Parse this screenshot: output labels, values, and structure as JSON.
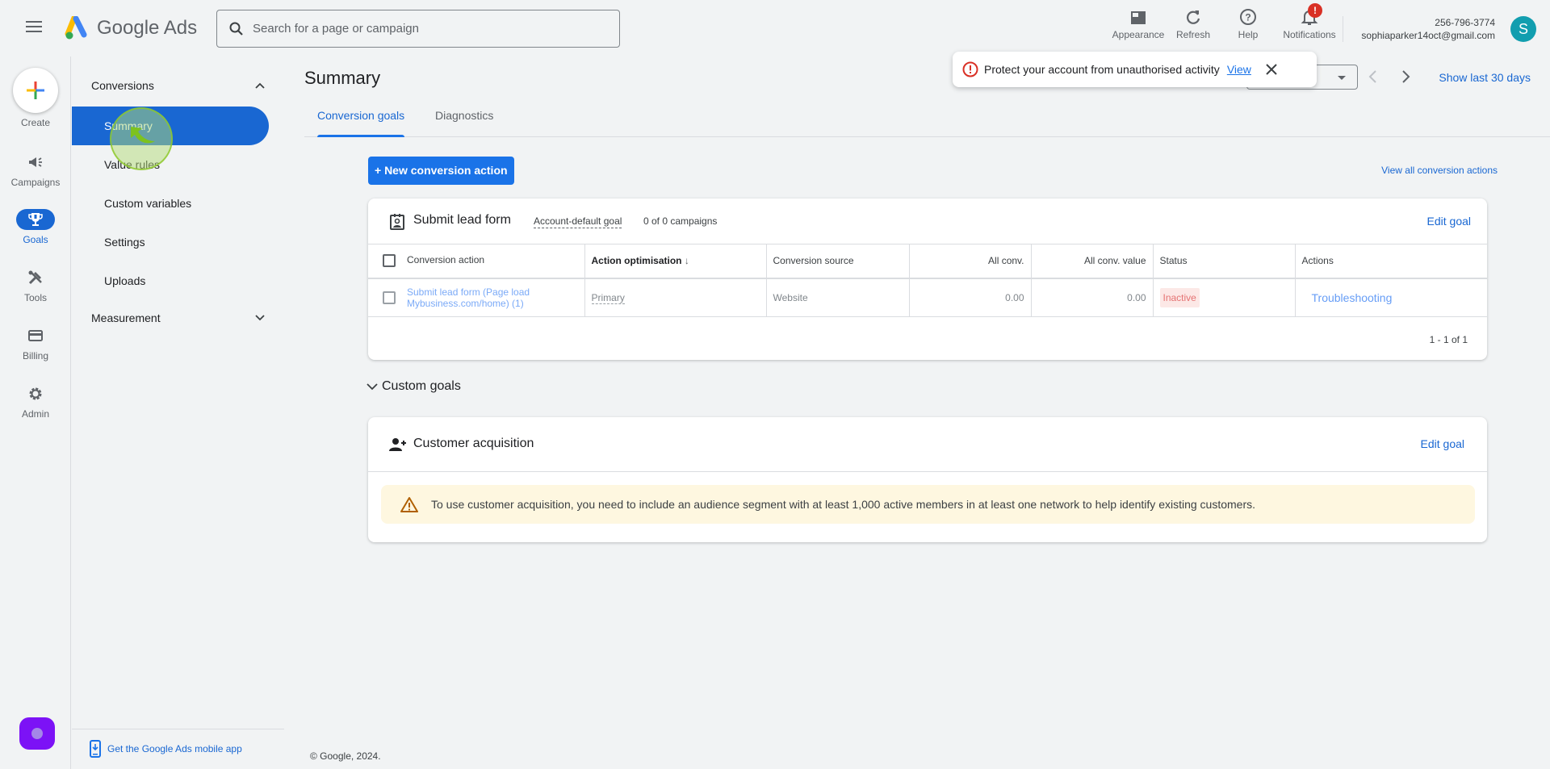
{
  "app": {
    "title": "Google Ads",
    "search_placeholder": "Search for a page or campaign"
  },
  "top_actions": [
    {
      "label": "Appearance",
      "icon": "appearance-icon"
    },
    {
      "label": "Refresh",
      "icon": "refresh-icon"
    },
    {
      "label": "Help",
      "icon": "help-icon"
    },
    {
      "label": "Notifications",
      "icon": "bell-icon",
      "badge": "!"
    }
  ],
  "account": {
    "phone": "256-796-3774",
    "email": "sophiaparker14oct@gmail.com",
    "avatar_letter": "S"
  },
  "rail": {
    "create_label": "Create",
    "items": [
      {
        "label": "Campaigns",
        "icon": "megaphone-icon"
      },
      {
        "label": "Goals",
        "icon": "trophy-icon",
        "active": true
      },
      {
        "label": "Tools",
        "icon": "tools-icon"
      },
      {
        "label": "Billing",
        "icon": "credit-card-icon"
      },
      {
        "label": "Admin",
        "icon": "gear-icon"
      }
    ]
  },
  "subnav": {
    "groups": [
      {
        "label": "Conversions",
        "expanded": true
      },
      {
        "label": "Measurement",
        "expanded": false
      }
    ],
    "items": [
      {
        "label": "Summary",
        "active": true
      },
      {
        "label": "Value rules"
      },
      {
        "label": "Custom variables"
      },
      {
        "label": "Settings"
      },
      {
        "label": "Uploads"
      }
    ],
    "mobile_app_link": "Get the Google Ads mobile app"
  },
  "main": {
    "page_title": "Summary",
    "tabs": [
      {
        "label": "Conversion goals",
        "active": true
      },
      {
        "label": "Diagnostics"
      }
    ],
    "date_range_label": "Show last 30 days",
    "new_action_label": "+ New conversion action",
    "view_all_label": "View all conversion actions",
    "goal_card": {
      "title": "Submit lead form",
      "chip": "Account-default goal",
      "campaigns": "0 of 0 campaigns",
      "edit_label": "Edit goal",
      "columns": [
        "Conversion action",
        "Action optimisation",
        "Conversion source",
        "All conv.",
        "All conv. value",
        "Status",
        "Actions"
      ],
      "rows": [
        {
          "action": "Submit lead form (Page load Mybusiness.com/home) (1)",
          "optimisation": "Primary",
          "source": "Website",
          "all_conv": "0.00",
          "all_conv_value": "0.00",
          "status": "Inactive",
          "actions": "Troubleshooting"
        }
      ],
      "pagination": "1 - 1 of 1"
    },
    "custom_goals_label": "Custom goals",
    "customer_card": {
      "title": "Customer acquisition",
      "edit_label": "Edit goal",
      "warning": "To use customer acquisition, you need to include an audience segment with at least 1,000 active members in at least one network to help identify existing customers."
    },
    "copyright": "© Google, 2024."
  },
  "toast": {
    "message": "Protect your account from unauthorised activity",
    "link": "View"
  },
  "colors": {
    "accent": "#1a73e8",
    "active_nav": "#1967d2",
    "status_inactive": "#e57373",
    "warning_bg": "#fef7e0",
    "avatar": "#129eaf",
    "alert": "#d93025"
  }
}
